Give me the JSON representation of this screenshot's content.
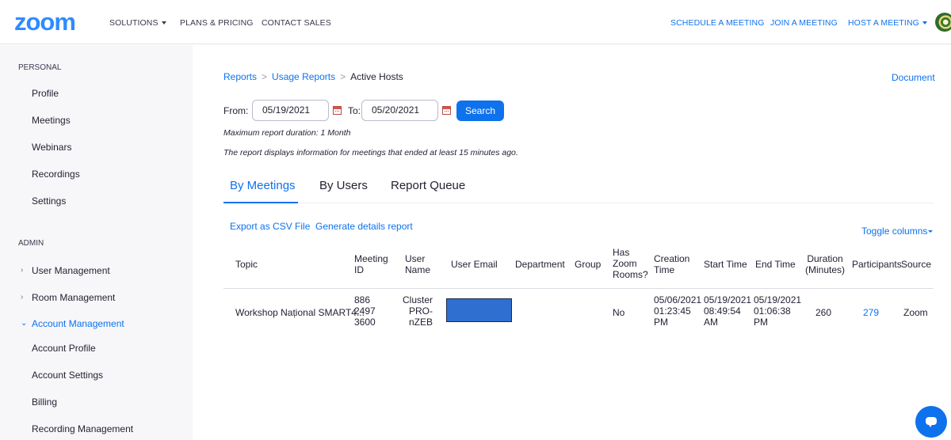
{
  "brand": {
    "logo": "zoom",
    "accent": "#0e72ed"
  },
  "topnav": {
    "solutions": "SOLUTIONS",
    "plans": "PLANS & PRICING",
    "contact": "CONTACT SALES",
    "schedule": "SCHEDULE A MEETING",
    "join": "JOIN A MEETING",
    "host": "HOST A MEETING"
  },
  "sidebar": {
    "personal_label": "PERSONAL",
    "personal_items": [
      "Profile",
      "Meetings",
      "Webinars",
      "Recordings",
      "Settings"
    ],
    "admin_label": "ADMIN",
    "admin_groups": [
      "User Management",
      "Room Management",
      "Account Management"
    ],
    "account_items": [
      "Account Profile",
      "Account Settings",
      "Billing",
      "Recording Management"
    ]
  },
  "breadcrumb": {
    "reports": "Reports",
    "usage": "Usage Reports",
    "current": "Active Hosts",
    "sep": ">"
  },
  "document_link": "Document",
  "filter": {
    "from_label": "From:",
    "from_value": "05/19/2021",
    "to_label": "To:",
    "to_value": "05/20/2021",
    "search_label": "Search",
    "max_note": "Maximum report duration: 1 Month",
    "info_note": "The report displays information for meetings that ended at least 15 minutes ago."
  },
  "tabs": [
    "By Meetings",
    "By Users",
    "Report Queue"
  ],
  "actions": {
    "export": "Export as CSV File",
    "details": "Generate details report",
    "toggle": "Toggle columns"
  },
  "table": {
    "headers": {
      "topic": "Topic",
      "meeting_id": [
        "Meeting",
        "ID"
      ],
      "user_name": [
        "User",
        "Name"
      ],
      "user_email": "User Email",
      "department": "Department",
      "group": "Group",
      "has_zoom_rooms": [
        "Has",
        "Zoom",
        "Rooms?"
      ],
      "creation_time": [
        "Creation",
        "Time"
      ],
      "start_time": "Start Time",
      "end_time": "End Time",
      "duration": [
        "Duration",
        "(Minutes)"
      ],
      "participants": "Participants",
      "source": "Source"
    },
    "row": {
      "topic": "Workshop Național SMART4...",
      "meeting_id": [
        "886",
        "2497",
        "3600"
      ],
      "user_name": [
        "Cluster",
        "PRO-",
        "nZEB"
      ],
      "has_zoom_rooms": "No",
      "creation_time": [
        "05/06/2021",
        "01:23:45",
        "PM"
      ],
      "start_time": [
        "05/19/2021",
        "08:49:54",
        "AM"
      ],
      "end_time": [
        "05/19/2021",
        "01:06:38",
        "PM"
      ],
      "duration": "260",
      "participants": "279",
      "source": "Zoom"
    }
  }
}
